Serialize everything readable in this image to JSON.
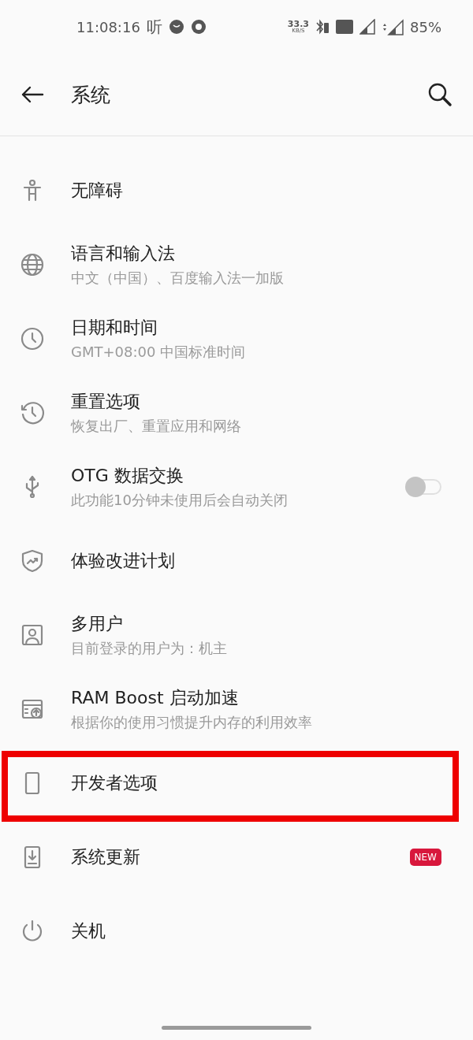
{
  "status_bar": {
    "time": "11:08:16",
    "app_glyph": "听",
    "speed": "33.3",
    "speed_unit": "KB/S",
    "battery": "85%"
  },
  "toolbar": {
    "title": "系统"
  },
  "items": [
    {
      "kind": "plain",
      "title": "无障碍",
      "highlighted": false
    },
    {
      "kind": "plain",
      "title": "语言和输入法",
      "subtitle": "中文（中国）、百度输入法一加版",
      "highlighted": false
    },
    {
      "kind": "plain",
      "title": "日期和时间",
      "subtitle": "GMT+08:00 中国标准时间",
      "highlighted": false
    },
    {
      "kind": "plain",
      "title": "重置选项",
      "subtitle": "恢复出厂、重置应用和网络",
      "highlighted": false
    },
    {
      "kind": "toggle",
      "title": "OTG 数据交换",
      "subtitle": "此功能10分钟未使用后会自动关闭",
      "on": false,
      "highlighted": false
    },
    {
      "kind": "plain",
      "title": "体验改进计划",
      "highlighted": false
    },
    {
      "kind": "plain",
      "title": "多用户",
      "subtitle": "目前登录的用户为：机主",
      "highlighted": false
    },
    {
      "kind": "plain",
      "title": "RAM Boost 启动加速",
      "subtitle": "根据你的使用习惯提升内存的利用效率",
      "highlighted": false
    },
    {
      "kind": "plain",
      "title": "开发者选项",
      "highlighted": true
    },
    {
      "kind": "badge",
      "title": "系统更新",
      "badge": "NEW",
      "highlighted": false
    },
    {
      "kind": "plain",
      "title": "关机",
      "highlighted": false
    }
  ]
}
